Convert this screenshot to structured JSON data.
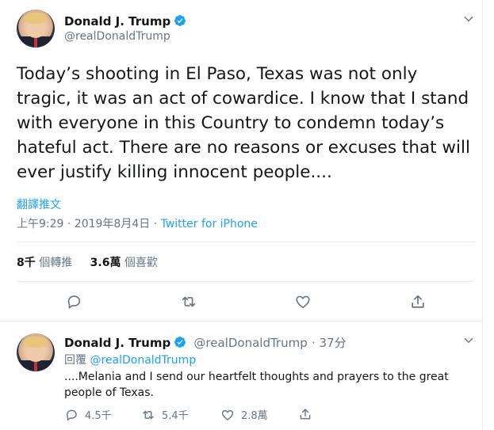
{
  "main_tweet": {
    "author_name": "Donald J. Trump",
    "handle": "@realDonaldTrump",
    "text": "Today’s shooting in El Paso, Texas was not only tragic, it was an act of cowardice. I know that I stand with everyone in this Country to condemn today’s hateful act. There are no reasons or excuses that will ever justify killing innocent people....",
    "translate_label": "翻譯推文",
    "time": "上午9:29 · 2019年8月4日",
    "separator": " · ",
    "source": "Twitter for iPhone",
    "retweets_count": "8千",
    "retweets_label": "個轉推",
    "likes_count": "3.6萬",
    "likes_label": "個喜歡",
    "icons": [
      "reply-icon",
      "retweet-icon",
      "like-icon",
      "share-icon"
    ]
  },
  "reply_tweet": {
    "author_name": "Donald J. Trump",
    "handle": "@realDonaldTrump",
    "age": "· 37分",
    "reply_prefix": "回覆",
    "reply_to": "@realDonaldTrump",
    "text": "....Melania and I send our heartfelt thoughts and prayers to the great people of Texas.",
    "reply_count": "4.5千",
    "retweet_count": "5.4千",
    "like_count": "2.8萬"
  },
  "colors": {
    "accent": "#1da1f2",
    "secondary_text": "#657786",
    "border": "#e6ecf0"
  }
}
